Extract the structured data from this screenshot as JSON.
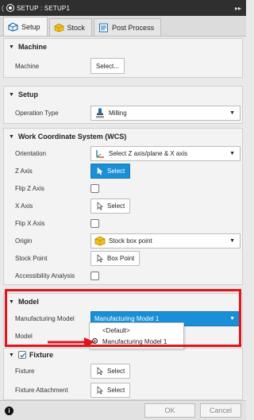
{
  "titlebar": {
    "title": "SETUP : SETUP1",
    "left_glyph": "("
  },
  "tabs": [
    {
      "label": "Setup",
      "icon": "setup-icon"
    },
    {
      "label": "Stock",
      "icon": "stock-icon"
    },
    {
      "label": "Post Process",
      "icon": "post-process-icon"
    }
  ],
  "machine": {
    "heading": "Machine",
    "rows": [
      {
        "label": "Machine",
        "button": "Select..."
      }
    ]
  },
  "setup": {
    "heading": "Setup",
    "operation_type_label": "Operation Type",
    "operation_type_value": "Milling"
  },
  "wcs": {
    "heading": "Work Coordinate System (WCS)",
    "orientation_label": "Orientation",
    "orientation_value": "Select Z axis/plane & X axis",
    "z_axis_label": "Z Axis",
    "z_axis_button": "Select",
    "flip_z_label": "Flip Z Axis",
    "x_axis_label": "X Axis",
    "x_axis_button": "Select",
    "flip_x_label": "Flip X Axis",
    "origin_label": "Origin",
    "origin_value": "Stock box point",
    "stock_point_label": "Stock Point",
    "stock_point_button": "Box Point",
    "accessibility_label": "Accessibility Analysis"
  },
  "model": {
    "heading": "Model",
    "manufacturing_model_label": "Manufacturing Model",
    "manufacturing_model_value": "Manufacturing Model 1",
    "model_label": "Model",
    "options": [
      "<Default>",
      "Manufacturing Model 1"
    ],
    "selected_option_index": 1
  },
  "fixture": {
    "heading": "Fixture",
    "fixture_label": "Fixture",
    "fixture_button": "Select",
    "attachment_label": "Fixture Attachment",
    "attachment_button": "Select"
  },
  "footer": {
    "ok": "OK",
    "cancel": "Cancel",
    "info": "i"
  },
  "colors": {
    "accent": "#1a8fd6",
    "highlight_red": "#e2141b",
    "title_bar": "#2f2f2f"
  }
}
